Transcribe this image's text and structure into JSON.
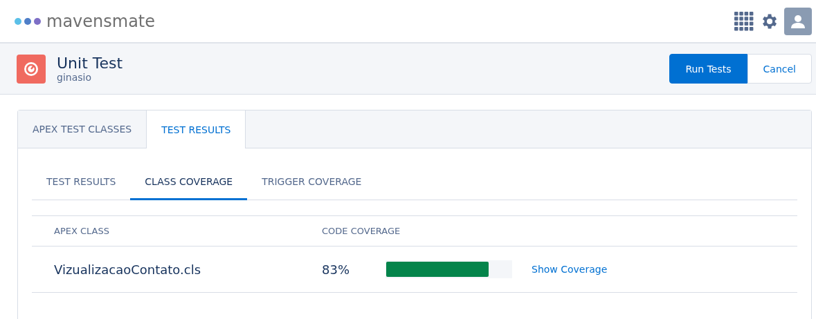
{
  "brand": {
    "name": "mavensmate"
  },
  "page_header": {
    "title": "Unit Test",
    "subtitle": "ginasio",
    "buttons": [
      {
        "label": "Run Tests",
        "kind": "primary"
      },
      {
        "label": "Cancel",
        "kind": "neutral"
      }
    ]
  },
  "tabs": [
    {
      "label": "APEX TEST CLASSES",
      "selected": false
    },
    {
      "label": "TEST RESULTS",
      "selected": true
    }
  ],
  "subtabs": [
    {
      "label": "TEST RESULTS",
      "selected": false
    },
    {
      "label": "CLASS COVERAGE",
      "selected": true
    },
    {
      "label": "TRIGGER COVERAGE",
      "selected": false
    }
  ],
  "table": {
    "columns": [
      "APEX CLASS",
      "CODE COVERAGE"
    ],
    "rows": [
      {
        "apex_class": "VizualizacaoContato.cls",
        "coverage": "83%",
        "level": 0.82,
        "link": "Show Coverage"
      }
    ]
  }
}
